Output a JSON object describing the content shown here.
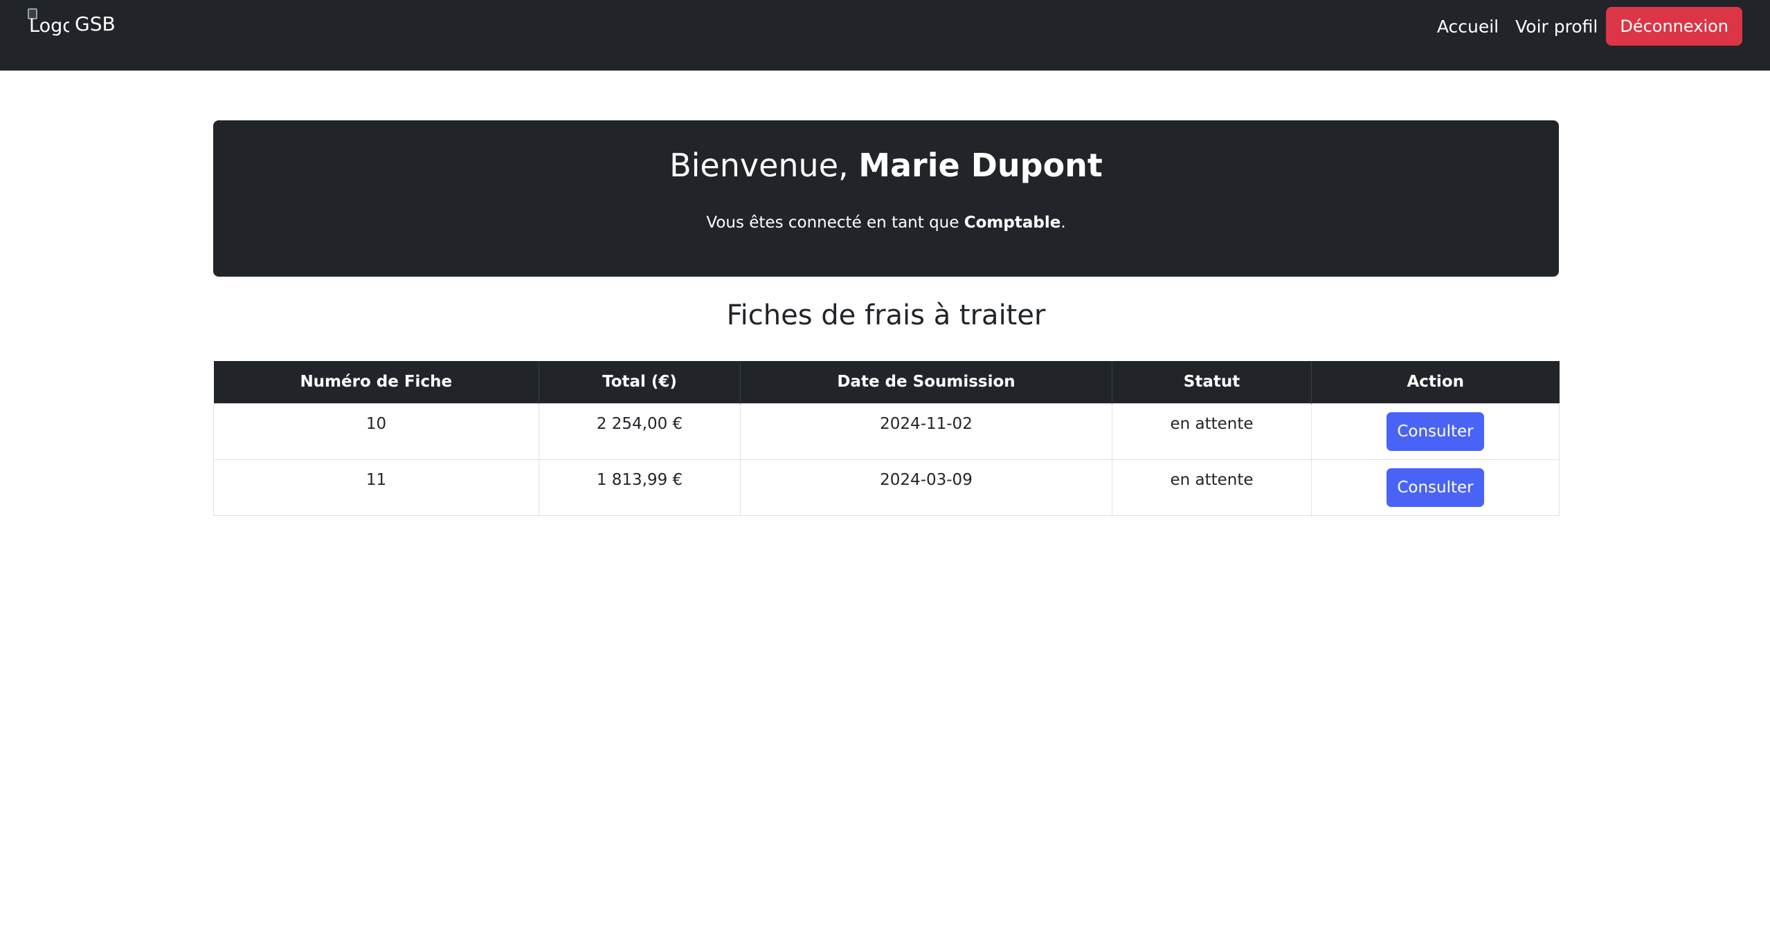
{
  "navbar": {
    "logo_alt": "Logo",
    "brand": "GSB",
    "links": {
      "home": "Accueil",
      "profile": "Voir profil"
    },
    "logout_label": "Déconnexion"
  },
  "hero": {
    "greeting": "Bienvenue, ",
    "user_name": "Marie Dupont",
    "sub_prefix": "Vous êtes connecté en tant que ",
    "role": "Comptable",
    "sub_suffix": "."
  },
  "section": {
    "title": "Fiches de frais à traiter"
  },
  "table": {
    "headers": [
      "Numéro de Fiche",
      "Total (€)",
      "Date de Soumission",
      "Statut",
      "Action"
    ],
    "rows": [
      {
        "numero": "10",
        "total": "2 254,00 €",
        "date": "2024-11-02",
        "statut": "en attente",
        "action": "Consulter"
      },
      {
        "numero": "11",
        "total": "1 813,99 €",
        "date": "2024-03-09",
        "statut": "en attente",
        "action": "Consulter"
      }
    ]
  },
  "colors": {
    "dark": "#212529",
    "danger": "#dc3545",
    "primary": "#4a63f7"
  }
}
